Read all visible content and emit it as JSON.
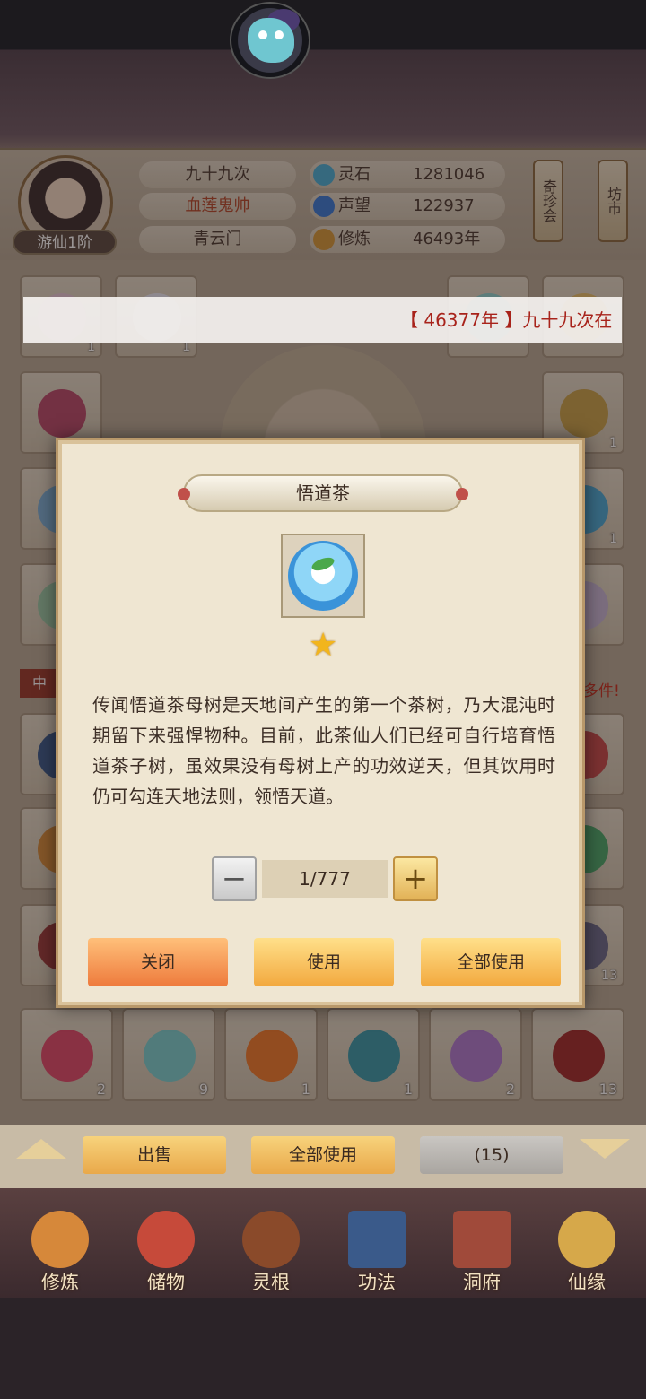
{
  "player": {
    "rank": "游仙1阶",
    "name": "九十九次",
    "title": "血莲鬼帅",
    "sect": "青云门"
  },
  "stats": [
    {
      "label": "灵石",
      "value": "1281046",
      "icon": "spirit-stone-icon",
      "color": "#4ab0d6"
    },
    {
      "label": "声望",
      "value": "122937",
      "icon": "prestige-icon",
      "color": "#3a7ad6"
    },
    {
      "label": "修炼",
      "value": "46493年",
      "icon": "cultivation-icon",
      "color": "#d69a3a"
    }
  ],
  "side_buttons": {
    "treasure": "奇珍会",
    "market": "坊市"
  },
  "marquee": "【 46377年 】九十九次在",
  "side_notes": {
    "left": "中",
    "right": "多件!"
  },
  "bottom_row_counts": [
    "2",
    "9",
    "1",
    "1",
    "2",
    "13"
  ],
  "cell_counts": [
    "1",
    "1",
    "1",
    "1",
    "13"
  ],
  "actions": {
    "sell": "出售",
    "use_all": "全部使用",
    "count": "(15)"
  },
  "nav": [
    {
      "label": "修炼",
      "icon": "cultivate-icon"
    },
    {
      "label": "储物",
      "icon": "storage-bag-icon"
    },
    {
      "label": "灵根",
      "icon": "spirit-root-icon"
    },
    {
      "label": "功法",
      "icon": "technique-book-icon"
    },
    {
      "label": "洞府",
      "icon": "cave-dwelling-icon"
    },
    {
      "label": "仙缘",
      "icon": "fortune-icon"
    }
  ],
  "modal": {
    "title": "悟道茶",
    "stars": "★",
    "description": "传闻悟道茶母树是天地间产生的第一个茶树，乃大混沌时期留下来强悍物种。目前，此茶仙人们已经可自行培育悟道茶子树，虽效果没有母树上产的功效逆天，但其饮用时仍可勾连天地法则，领悟天道。",
    "quantity": "1/777",
    "minus": "−",
    "plus": "+",
    "close": "关闭",
    "use": "使用",
    "use_all": "全部使用"
  }
}
